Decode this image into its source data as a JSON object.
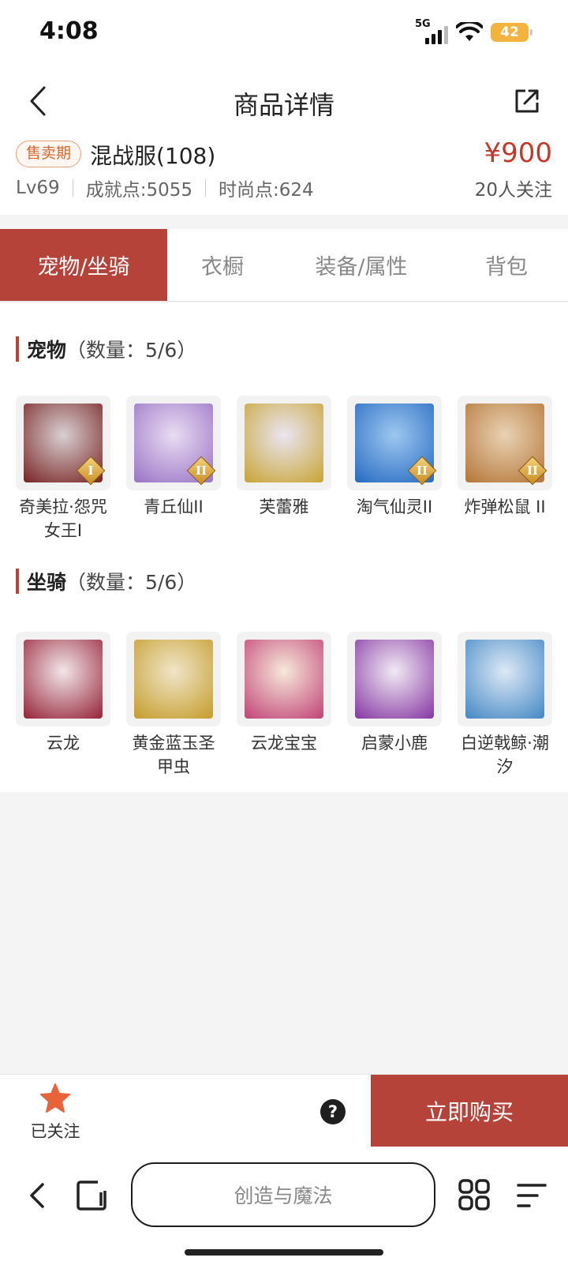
{
  "status_bar": {
    "time": "4:08",
    "network": "5G",
    "battery": "42"
  },
  "header": {
    "title": "商品详情"
  },
  "product": {
    "badge": "售卖期",
    "server": "混战服(108)",
    "price": "¥900",
    "level": "Lv69",
    "achievement": "成就点:5055",
    "fashion": "时尚点:624",
    "followers": "20人关注"
  },
  "tabs": [
    "宠物/坐骑",
    "衣橱",
    "装备/属性",
    "背包"
  ],
  "pets": {
    "title": "宠物",
    "count": "（数量：5/6）",
    "items": [
      {
        "label": "奇美拉·怨咒女王I",
        "rank": "I",
        "colors": [
          "#d9d0d2",
          "#7d2b2b"
        ]
      },
      {
        "label": "青丘仙II",
        "rank": "II",
        "colors": [
          "#e9dcf2",
          "#9d78c8"
        ]
      },
      {
        "label": "芙蕾雅",
        "rank": "",
        "colors": [
          "#eae6f3",
          "#caa73d"
        ]
      },
      {
        "label": "淘气仙灵II",
        "rank": "II",
        "colors": [
          "#9ec7f0",
          "#2b6fc4"
        ]
      },
      {
        "label": "炸弹松鼠 II",
        "rank": "II",
        "colors": [
          "#e9d2b4",
          "#b77a3d"
        ]
      }
    ]
  },
  "mounts": {
    "title": "坐骑",
    "count": "（数量：5/6）",
    "items": [
      {
        "label": "云龙",
        "colors": [
          "#f2e6ea",
          "#9a2c3f"
        ]
      },
      {
        "label": "黄金蓝玉圣甲虫",
        "colors": [
          "#f0e5c8",
          "#c7a033"
        ]
      },
      {
        "label": "云龙宝宝",
        "colors": [
          "#f6e9da",
          "#c44a7b"
        ]
      },
      {
        "label": "启蒙小鹿",
        "colors": [
          "#f1eaf4",
          "#8b3fa6"
        ]
      },
      {
        "label": "白逆戟鲸·潮汐",
        "colors": [
          "#dde9f6",
          "#4b8cc7"
        ]
      }
    ]
  },
  "action_bar": {
    "fav_label": "已关注",
    "help": "?",
    "buy_label": "立即购买"
  },
  "browser": {
    "url_text": "创造与魔法"
  },
  "colors": {
    "accent": "#b6433a",
    "price": "#c0392b",
    "badge": "#d7662e",
    "star": "#e8623a"
  }
}
